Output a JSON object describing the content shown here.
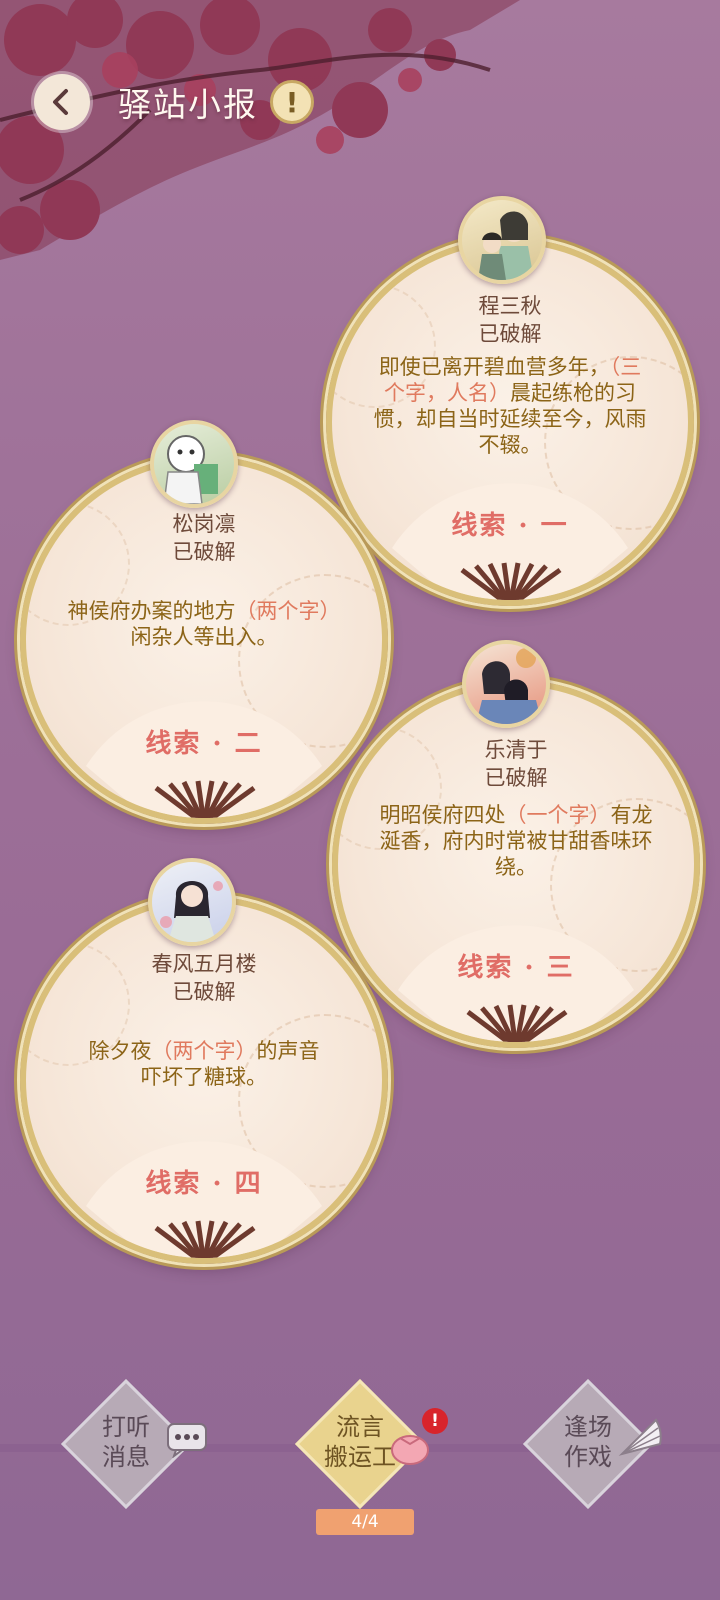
{
  "header": {
    "title": "驿站小报",
    "info_glyph": "!"
  },
  "clues": [
    {
      "name": "程三秋",
      "status": "已破解",
      "text_parts": [
        "即使已离开碧血营多年，",
        "（三个字，人名）",
        "晨起练枪的习惯，却自当时延续至今，风雨不辍。"
      ],
      "label": "线索 · 一"
    },
    {
      "name": "松岗凛",
      "status": "已破解",
      "text_parts": [
        "神侯府办案的地方",
        "（两个字）",
        "闲杂人等出入。"
      ],
      "label": "线索 · 二"
    },
    {
      "name": "乐清于",
      "status": "已破解",
      "text_parts": [
        "明昭侯府四处",
        "（一个字）",
        "有龙涎香，府内时常被甘甜香味环绕。"
      ],
      "label": "线索 · 三"
    },
    {
      "name": "春风五月楼",
      "status": "已破解",
      "text_parts": [
        "除夕夜",
        "（两个字）",
        "的声音吓坏了糖球。"
      ],
      "label": "线索 · 四"
    }
  ],
  "nav": {
    "inquire": "打听消息",
    "inquire_l1": "打听",
    "inquire_l2": "消息",
    "rumor_l1": "流言",
    "rumor_l2": "搬运工",
    "rumor_count": "4/4",
    "rumor_badge": "!",
    "scene_l1": "逢场",
    "scene_l2": "作戏"
  },
  "colors": {
    "accent_text": "#8c6417",
    "highlight": "#e07a5e",
    "label_red": "#e06d66",
    "gold_border": "#d9bf79"
  }
}
